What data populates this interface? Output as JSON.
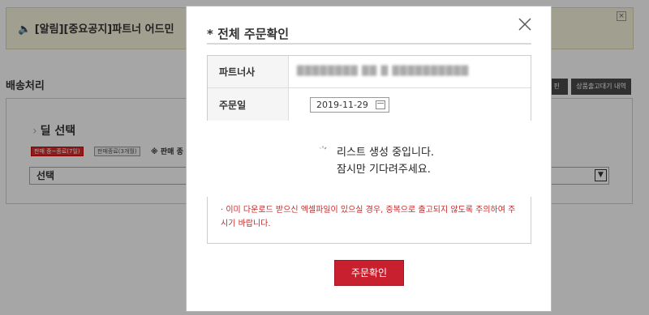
{
  "notice": {
    "text": "🔈 [알림][중요공지]파트너 어드민",
    "close_glyph": "×"
  },
  "section": {
    "title": "배송처리",
    "button_a": "핀",
    "button_b": "상품출고대기 내역"
  },
  "deal": {
    "title": "딜 선택",
    "arrow_glyph": "›",
    "tag_active": "판매 중~종료(7일)",
    "tag_ended": "판매종료(3개월)",
    "tag_note": "※ 판매 종",
    "select_value": "선택",
    "select_caret": "▼"
  },
  "modal": {
    "title": "* 전체 주문확인",
    "partner_label": "파트너사",
    "partner_value": "████████ ██ █ ██████████",
    "order_date_label": "주문일",
    "order_date_value": "2019-11-29",
    "warning_text": "· 이미 다운로드 받으신 엑셀파일이 있으실 경우, 중복으로 출고되지 않도록 주의하여 주시기 바랍니다.",
    "confirm_button": "주문확인"
  },
  "loading": {
    "line1": "리스트 생성 중입니다.",
    "line2": "잠시만 기다려주세요."
  },
  "colors": {
    "accent_red": "#c8202e",
    "notice_bg": "#f8f5dc",
    "warning_text": "#c62828"
  }
}
